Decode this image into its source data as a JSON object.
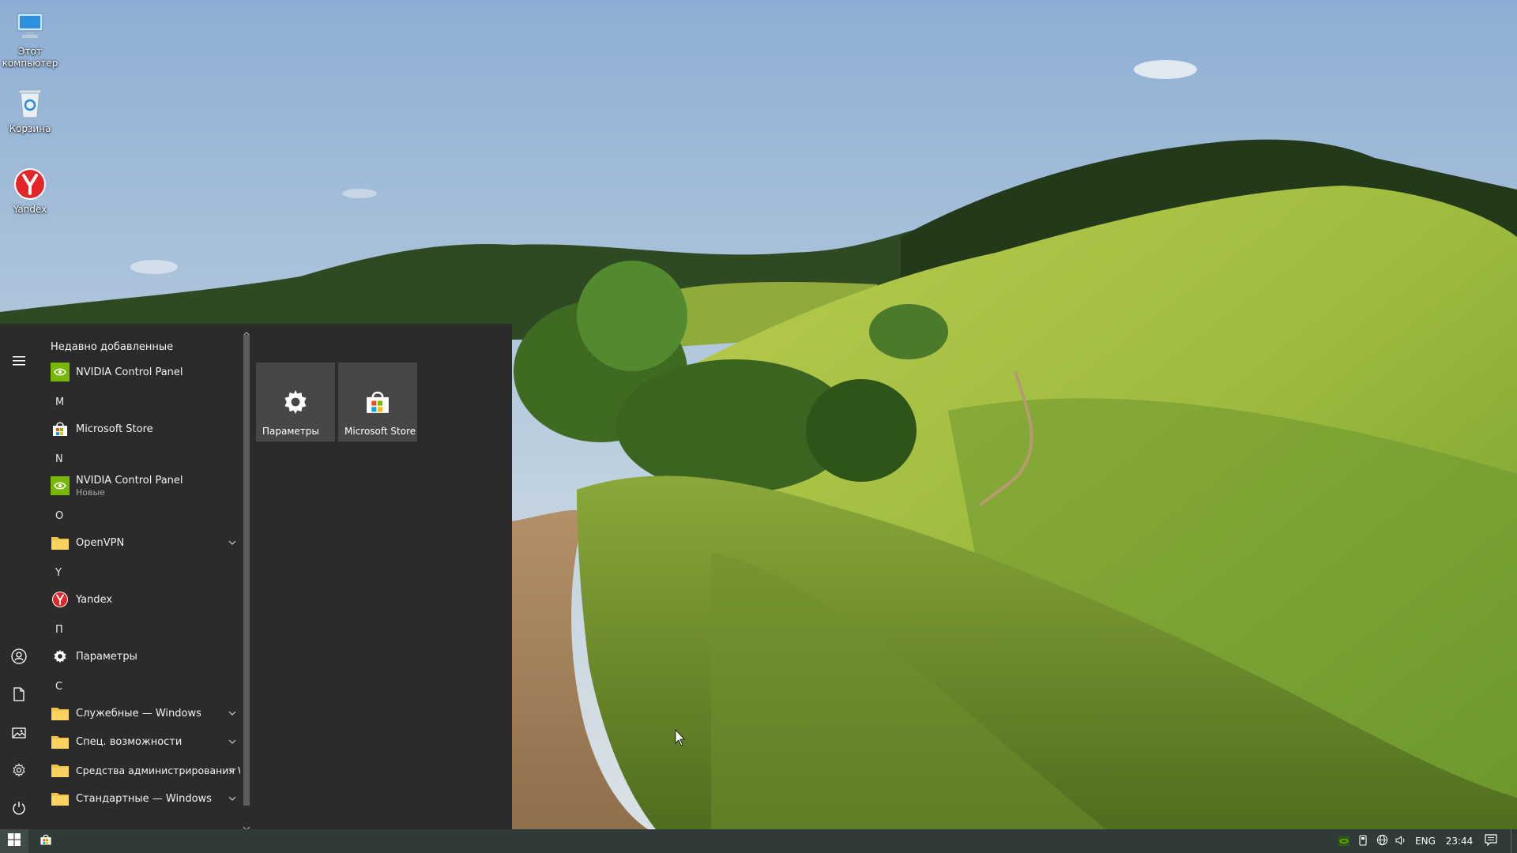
{
  "desktop": {
    "icons": [
      {
        "name": "this-pc",
        "label": "Этот компьютер"
      },
      {
        "name": "recycle-bin",
        "label": "Корзина"
      },
      {
        "name": "yandex",
        "label": "Yandex"
      }
    ]
  },
  "start_menu": {
    "rail": {
      "icons": [
        "hamburger-icon",
        "user-icon",
        "documents-icon",
        "pictures-icon",
        "gear-icon",
        "power-icon"
      ]
    },
    "recently_added_title": "Недавно добавленные",
    "items": {
      "nvidia_recent": {
        "label": "NVIDIA Control Panel",
        "icon": "nvidia-icon"
      },
      "letter_m": "M",
      "ms_store": {
        "label": "Microsoft Store",
        "icon": "store-icon"
      },
      "letter_n": "N",
      "nvidia": {
        "label": "NVIDIA Control Panel",
        "sublabel": "Новые",
        "icon": "nvidia-icon"
      },
      "letter_o": "O",
      "openvpn": {
        "label": "OpenVPN",
        "icon": "folder-icon"
      },
      "letter_y": "Y",
      "yandex": {
        "label": "Yandex",
        "icon": "yandex-icon"
      },
      "letter_p": "П",
      "settings": {
        "label": "Параметры",
        "icon": "gear-icon"
      },
      "letter_s": "С",
      "windows_tools": {
        "label": "Служебные — Windows",
        "icon": "folder-icon"
      },
      "accessibility": {
        "label": "Спец. возможности",
        "icon": "folder-icon"
      },
      "admin_tools": {
        "label": "Средства администрирования W...",
        "icon": "folder-icon"
      },
      "windows_accessories": {
        "label": "Стандартные — Windows",
        "icon": "folder-icon"
      }
    },
    "tiles": [
      {
        "label": "Параметры",
        "icon": "gear-icon"
      },
      {
        "label": "Microsoft Store",
        "icon": "store-icon"
      }
    ]
  },
  "taskbar": {
    "language": "ENG",
    "time": "23:44",
    "tray_icons": [
      "nvidia-tray-icon",
      "usb-icon",
      "network-icon",
      "volume-icon",
      "notification-icon"
    ]
  },
  "colors": {
    "start_bg": "#2b2b2b",
    "tile_bg": "#474747",
    "folder": "#f5c242",
    "nvidia": "#76b900",
    "yandex": "#e4262b"
  }
}
